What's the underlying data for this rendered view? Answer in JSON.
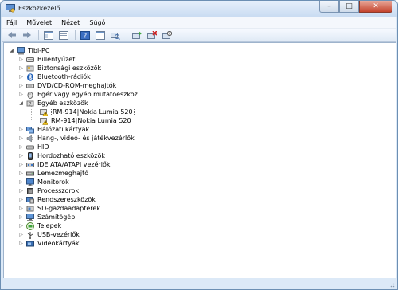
{
  "window": {
    "title": "Eszközkezelő",
    "minimize": "–",
    "maximize": "□",
    "close": "✕"
  },
  "menu": [
    "Fájl",
    "Művelet",
    "Nézet",
    "Súgó"
  ],
  "tree": {
    "root": "Tibi-PC",
    "items": [
      {
        "label": "Billentyűzet",
        "icon": "keyboard-icon"
      },
      {
        "label": "Biztonsági eszközök",
        "icon": "security-device-icon"
      },
      {
        "label": "Bluetooth-rádiók",
        "icon": "bluetooth-icon"
      },
      {
        "label": "DVD/CD-ROM-meghajtók",
        "icon": "disc-drive-icon"
      },
      {
        "label": "Egér vagy egyéb mutatóeszköz",
        "icon": "mouse-icon"
      },
      {
        "label": "Egyéb eszközök",
        "icon": "unknown-device-icon",
        "expanded": true,
        "children": [
          {
            "label": "RM-914|Nokia Lumia 520",
            "icon": "warning-device-icon",
            "selected": true
          },
          {
            "label": "RM-914|Nokia Lumia 520",
            "icon": "warning-device-icon"
          }
        ]
      },
      {
        "label": "Hálózati kártyák",
        "icon": "network-adapter-icon"
      },
      {
        "label": "Hang-, videó- és játékvezérlők",
        "icon": "speaker-icon"
      },
      {
        "label": "HID",
        "icon": "hid-icon"
      },
      {
        "label": "Hordozható eszközök",
        "icon": "portable-device-icon"
      },
      {
        "label": "IDE ATA/ATAPI vezérlők",
        "icon": "ide-controller-icon"
      },
      {
        "label": "Lemezmeghajtó",
        "icon": "disk-drive-icon"
      },
      {
        "label": "Monitorok",
        "icon": "monitor-icon"
      },
      {
        "label": "Processzorok",
        "icon": "processor-icon"
      },
      {
        "label": "Rendszereszközök",
        "icon": "system-device-icon"
      },
      {
        "label": "SD-gazdaadapterek",
        "icon": "sd-host-icon"
      },
      {
        "label": "Számítógép",
        "icon": "computer-icon"
      },
      {
        "label": "Telepek",
        "icon": "battery-icon"
      },
      {
        "label": "USB-vezérlők",
        "icon": "usb-icon"
      },
      {
        "label": "Videokártyák",
        "icon": "display-adapter-icon"
      }
    ]
  }
}
